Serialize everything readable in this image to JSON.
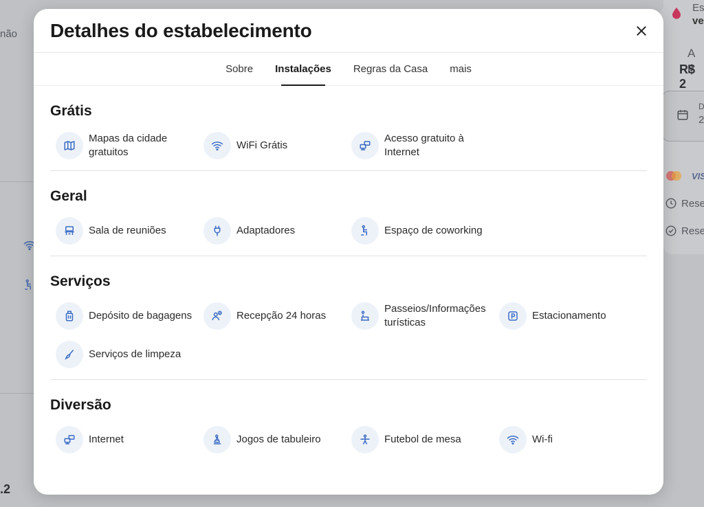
{
  "background": {
    "left_partial_text": "não",
    "right_top_text_1": "Es",
    "right_top_text_2": "ve",
    "right_price_label": "A p",
    "right_price_value": "R$ 2",
    "right_date_label": "D",
    "right_date_value": "2",
    "right_row_1": "Rese",
    "right_row_2": "Rese",
    "left_bottom_number": ".2",
    "card_brand_1": "mastercard",
    "card_brand_2": "VIS"
  },
  "modal": {
    "title": "Detalhes do estabelecimento",
    "close_icon": "close-icon"
  },
  "tabs": [
    {
      "label": "Sobre",
      "active": false
    },
    {
      "label": "Instalações",
      "active": true
    },
    {
      "label": "Regras da Casa",
      "active": false
    },
    {
      "label": "mais",
      "active": false
    }
  ],
  "sections": [
    {
      "title": "Grátis",
      "items": [
        {
          "label": "Mapas da cidade gratuitos",
          "icon": "map-icon"
        },
        {
          "label": "WiFi Grátis",
          "icon": "wifi-icon"
        },
        {
          "label": "Acesso gratuito à Internet",
          "icon": "network-icon"
        }
      ]
    },
    {
      "title": "Geral",
      "items": [
        {
          "label": "Sala de reuniões",
          "icon": "meeting-room-icon"
        },
        {
          "label": "Adaptadores",
          "icon": "plug-icon"
        },
        {
          "label": "Espaço de coworking",
          "icon": "coworking-icon"
        }
      ]
    },
    {
      "title": "Serviços",
      "items": [
        {
          "label": "Depósito de bagagens",
          "icon": "luggage-icon"
        },
        {
          "label": "Recepção 24 horas",
          "icon": "reception-icon"
        },
        {
          "label": "Passeios/Informações turísticas",
          "icon": "tour-icon"
        },
        {
          "label": "Estacionamento",
          "icon": "parking-icon"
        },
        {
          "label": "Serviços de limpeza",
          "icon": "cleaning-icon"
        }
      ]
    },
    {
      "title": "Diversão",
      "items": [
        {
          "label": "Internet",
          "icon": "network-icon"
        },
        {
          "label": "Jogos de tabuleiro",
          "icon": "board-game-icon"
        },
        {
          "label": "Futebol de mesa",
          "icon": "foosball-icon"
        },
        {
          "label": "Wi-fi",
          "icon": "wifi-icon"
        }
      ]
    }
  ],
  "colors": {
    "icon_blue": "#3b6cc4",
    "icon_bg": "#edf2f9"
  }
}
